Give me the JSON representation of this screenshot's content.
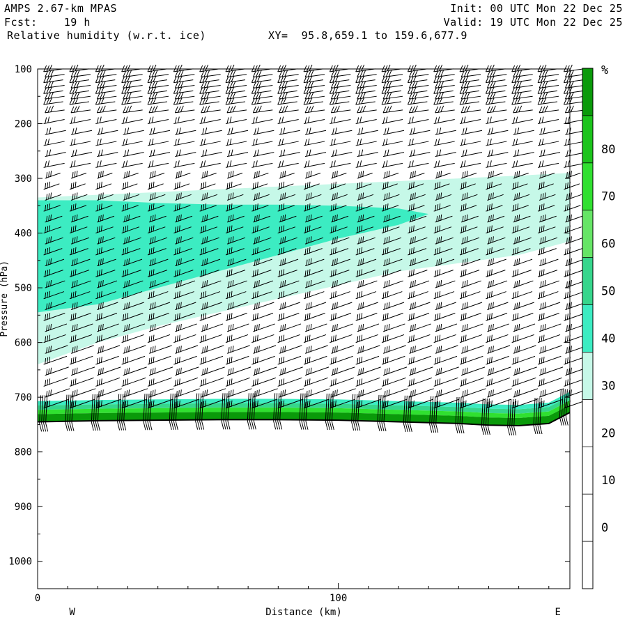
{
  "header": {
    "model": "AMPS 2.67-km MPAS",
    "fcst": "Fcst:    19 h",
    "field": "Relative humidity (w.r.t. ice)",
    "xy": "XY=  95.8,659.1 to 159.6,677.9",
    "init": "Init: 00 UTC Mon 22 Dec 25",
    "valid": "Valid: 19 UTC Mon 22 Dec 25"
  },
  "chart_data": {
    "type": "heatmap",
    "title": "Relative humidity (w.r.t. ice)",
    "xlabel": "Distance (km)",
    "ylabel": "Pressure (hPa)",
    "xlim": [
      0,
      177
    ],
    "ylim": [
      1050,
      100
    ],
    "x_ticks": [
      0,
      100
    ],
    "y_ticks": [
      100,
      200,
      300,
      400,
      500,
      600,
      700,
      800,
      900,
      1000
    ],
    "x_end_labels": [
      "W",
      "E"
    ],
    "colorbar": {
      "unit": "%",
      "labels": [
        80,
        70,
        60,
        50,
        40,
        30,
        20,
        10,
        0
      ],
      "bands": [
        {
          "from": 90,
          "to": 100,
          "color": "#0a9a0a"
        },
        {
          "from": 80,
          "to": 90,
          "color": "#1cc41c"
        },
        {
          "from": 70,
          "to": 80,
          "color": "#30e030"
        },
        {
          "from": 60,
          "to": 70,
          "color": "#66e566"
        },
        {
          "from": 50,
          "to": 60,
          "color": "#36d68c"
        },
        {
          "from": 40,
          "to": 50,
          "color": "#3cecc2"
        },
        {
          "from": 30,
          "to": 40,
          "color": "#c6f8e8"
        }
      ]
    },
    "rh_30_40_region": [
      [
        0,
        335
      ],
      [
        20,
        330
      ],
      [
        40,
        325
      ],
      [
        60,
        320
      ],
      [
        80,
        315
      ],
      [
        100,
        310
      ],
      [
        120,
        305
      ],
      [
        140,
        300
      ],
      [
        160,
        295
      ],
      [
        177,
        290
      ],
      [
        177,
        415
      ],
      [
        160,
        440
      ],
      [
        140,
        455
      ],
      [
        120,
        470
      ],
      [
        100,
        495
      ],
      [
        80,
        520
      ],
      [
        60,
        545
      ],
      [
        40,
        570
      ],
      [
        20,
        600
      ],
      [
        0,
        640
      ]
    ],
    "rh_40_50_region": [
      [
        0,
        340
      ],
      [
        20,
        340
      ],
      [
        40,
        345
      ],
      [
        60,
        348
      ],
      [
        80,
        348
      ],
      [
        100,
        350
      ],
      [
        120,
        355
      ],
      [
        130,
        365
      ],
      [
        120,
        385
      ],
      [
        100,
        410
      ],
      [
        80,
        440
      ],
      [
        60,
        470
      ],
      [
        40,
        500
      ],
      [
        20,
        530
      ],
      [
        0,
        545
      ]
    ],
    "terrain_surface_hpa": [
      [
        0,
        745
      ],
      [
        20,
        743
      ],
      [
        40,
        742
      ],
      [
        60,
        741
      ],
      [
        80,
        741
      ],
      [
        100,
        742
      ],
      [
        120,
        745
      ],
      [
        140,
        748
      ],
      [
        150,
        751
      ],
      [
        160,
        752
      ],
      [
        170,
        748
      ],
      [
        177,
        728
      ]
    ],
    "wind_barb_columns": 21,
    "wind_barb_levels_hpa": [
      105,
      115,
      125,
      135,
      145,
      155,
      165,
      180,
      200,
      220,
      240,
      260,
      280,
      300,
      320,
      340,
      360,
      380,
      400,
      420,
      440,
      460,
      480,
      500,
      520,
      540,
      560,
      580,
      600,
      620,
      640,
      660,
      680,
      700,
      720
    ]
  }
}
